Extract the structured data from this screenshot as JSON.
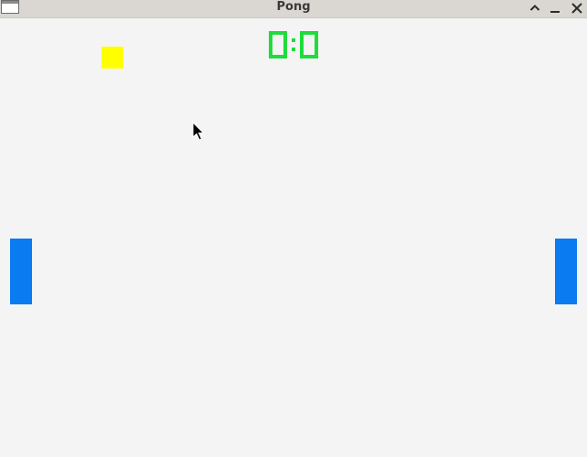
{
  "window": {
    "title": "Pong",
    "app_icon": "window-icon",
    "controls": {
      "maximize_icon": "chevron-up-icon",
      "minimize_icon": "minimize-icon",
      "close_icon": "close-icon"
    }
  },
  "game": {
    "score_left": 0,
    "score_right": 0,
    "score_separator": ":",
    "colors": {
      "background": "#f4f4f4",
      "score": "#1fdc3c",
      "paddle": "#0a7bf0",
      "ball": "#ffff00"
    }
  },
  "cursor": {
    "icon": "arrow-cursor-icon"
  }
}
